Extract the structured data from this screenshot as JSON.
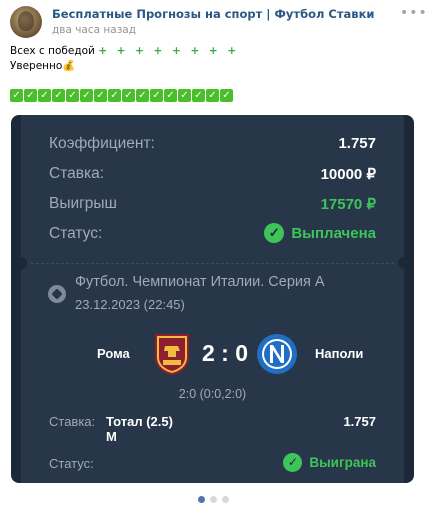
{
  "post": {
    "channel_name": "Бесплатные Прогнозы на спорт | Футбол Ставки",
    "time": "два часа назад",
    "line1_text": "Всех с победой",
    "line1_pluses": "+ + + + + + + +",
    "line2_text": "Уверенно💰",
    "check_count": 16
  },
  "ticket": {
    "coef_label": "Коэффициент:",
    "coef_value": "1.757",
    "stake_label": "Ставка:",
    "stake_value": "10000 ₽",
    "win_label": "Выигрыш",
    "win_value": "17570 ₽",
    "status_label": "Статус:",
    "status_value": "Выплачена"
  },
  "match": {
    "league": "Футбол. Чемпионат Италии. Серия А",
    "date": "23.12.2023 (22:45)",
    "home": "Рома",
    "away": "Наполи",
    "score": "2 : 0",
    "half_time": "2:0 (0:0,2:0)",
    "bet_label": "Ставка:",
    "bet_desc": "Тотал (2.5) М",
    "bet_odds": "1.757",
    "status_label": "Статус:",
    "status_value": "Выиграна"
  },
  "carousel": {
    "slides": 3,
    "active": 1
  },
  "colors": {
    "card_bg": "#273648",
    "accent_green": "#3ec55a",
    "link_blue": "#2a5885"
  }
}
